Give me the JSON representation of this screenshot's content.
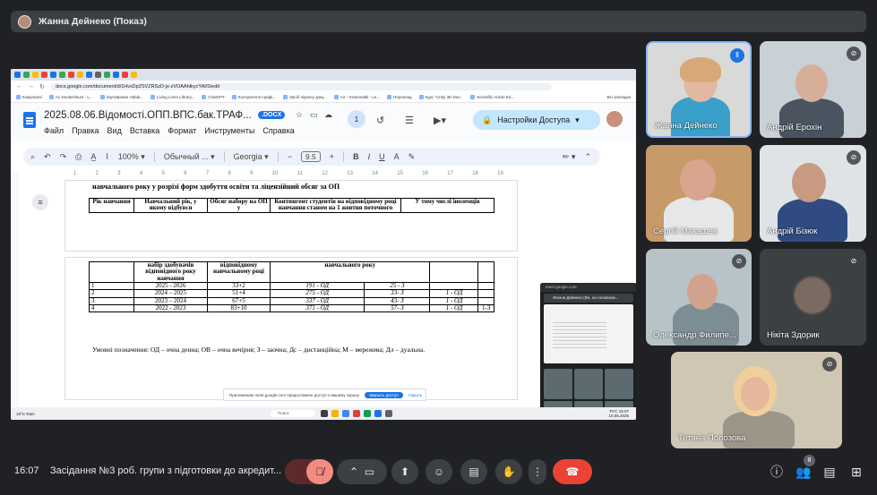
{
  "presenter": {
    "name": "Жанна Дейнеко (Показ)"
  },
  "browser": {
    "url": "docs.google.com/document/d/1HvxDp2SVZRSzD-js-zVOAAhtkycYAl/S/edit",
    "bookmarks": [
      "Комуналні",
      "A1 Deutschkurs - L...",
      "Заучивание Habla...",
      "Living Lines Library...",
      "ChatGPT",
      "Контрагенти графі...",
      "Засіб підпису доку...",
      "A2 - Grammatik - Le...",
      "Переклад",
      "Курс \"Unity 3D Dev...",
      "Scientific Article Ed..."
    ],
    "bookmarks_right": "Всі закладки"
  },
  "doc": {
    "title": "2025.08.06.Відомості.ОПП.ВПС.бак.ТРАФ...",
    "badge": ".DOCX",
    "menu": [
      "Файл",
      "Правка",
      "Вид",
      "Вставка",
      "Формат",
      "Инструменты",
      "Справка"
    ],
    "collaborators": "1",
    "share_label": "Настройки Доступа",
    "toolbar": {
      "zoom": "100%",
      "style": "Обычный ...",
      "font": "Georgia",
      "size": "9.5"
    },
    "ruler": [
      "1",
      "2",
      "3",
      "4",
      "5",
      "6",
      "7",
      "8",
      "9",
      "10",
      "11",
      "12",
      "13",
      "14",
      "15",
      "16",
      "17",
      "18",
      "19"
    ],
    "page1": {
      "heading": "навчального року у розрізі форм здобуття освіти та ліцензійний обсяг за ОП",
      "headers": [
        "Рік навчання",
        "Навчальний рік, у якому відбувся",
        "Обсяг набору на ОП у",
        "Контингент студентів на відповідному році навчання станом на 1 жовтня поточного",
        "У тому числі іноземців"
      ]
    },
    "page2": {
      "headers": [
        "набір здобувачів відповідного року навчання",
        "відповідному навчальному році",
        "навчального року"
      ],
      "rows": [
        [
          "1",
          "2025 - 2026",
          "33+2",
          "191 - ОД",
          "25 - З",
          "",
          ""
        ],
        [
          "2",
          "2024 – 2025",
          "51+4",
          "275 - ОД",
          "33- З",
          "1 - ОД",
          ""
        ],
        [
          "3",
          "2023 – 2024",
          "67+5",
          "337 - ОД",
          "43- З",
          "1 - ОД",
          ""
        ],
        [
          "4",
          "2022 - 2023",
          "83+10",
          "371 - ОД",
          "57- З",
          "1 - ОД",
          "1-З"
        ]
      ],
      "legend": "Умовні позначення: ОД – очна денна; ОВ – очна вечірня; З – заочна; Дс – дистанційна; М – мережева; Дл – дуальна."
    }
  },
  "phone": {
    "top_url": "meet.google.com",
    "presenter": "Жанна Дейнеко (Ви, на головном..."
  },
  "notice": {
    "text": "Приложению meet.google.com предоставлен доступ к вашему экрану",
    "share_button": "Закрыть доступ",
    "hide_link": "Скрыть"
  },
  "taskbar": {
    "weather_temp": "19°C",
    "weather_label": "Rain",
    "search": "Поиск",
    "lang": "РУС",
    "time": "16:07",
    "date": "10.08.2025"
  },
  "participants": [
    {
      "name": "Жанна Дейнеко",
      "speaking": true
    },
    {
      "name": "Андрій Ерохін",
      "muted": true
    },
    {
      "name": "Сергій Макашев",
      "muted": false
    },
    {
      "name": "Андрій Бізюк",
      "muted": true
    },
    {
      "name": "Олександр Филипе...",
      "muted": true
    },
    {
      "name": "Нікіта Здорик",
      "muted": true
    },
    {
      "name": "Тетяна Полозова",
      "muted": true
    }
  ],
  "bottom_bar": {
    "time": "16:07",
    "meeting_title": "Засідання №3 роб. групи з підготовки до акредит...",
    "people_count": "8"
  },
  "colors": {
    "accent": "#8ab4f8",
    "end_call": "#ea4335",
    "muted_mic": "#f28b82",
    "share_btn": "#c2e7ff"
  }
}
